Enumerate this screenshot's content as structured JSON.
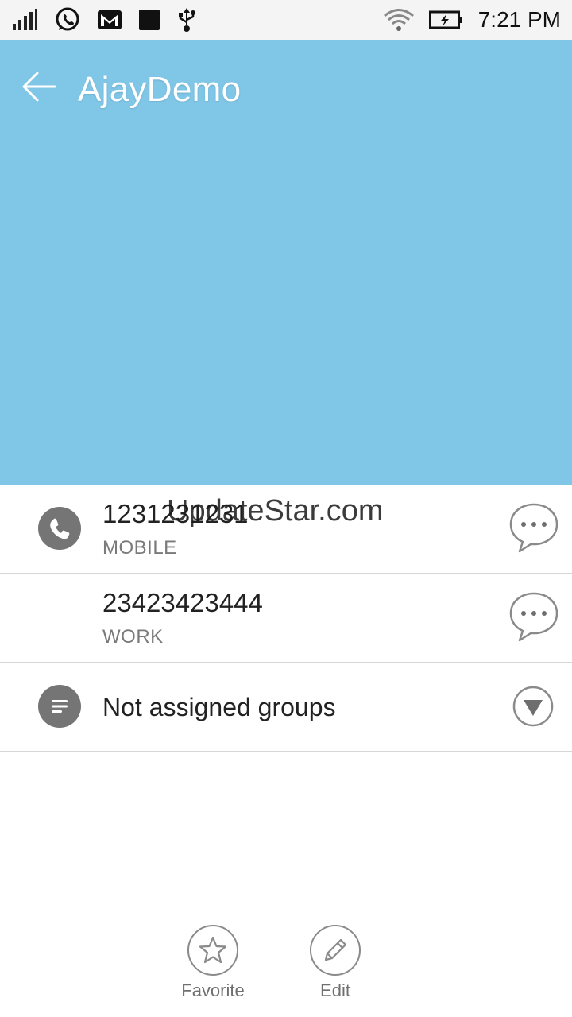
{
  "status_bar": {
    "time": "7:21 PM",
    "icons_left": [
      "signal-icon",
      "whatsapp-icon",
      "gmail-icon",
      "app-notification-icon",
      "usb-icon"
    ],
    "icons_right": [
      "wifi-icon",
      "battery-charging-icon"
    ]
  },
  "header": {
    "title": "AjayDemo",
    "background_color": "#80c6e7",
    "back_icon": "arrow-left-icon"
  },
  "phones": [
    {
      "number": "1231231231",
      "type": "MOBILE",
      "icon": "phone-icon",
      "action_icon": "message-bubble-icon"
    },
    {
      "number": "23423423444",
      "type": "WORK",
      "action_icon": "message-bubble-icon"
    }
  ],
  "groups": {
    "label": "Not assigned groups",
    "icon": "group-list-icon",
    "expand_icon": "triangle-down-icon"
  },
  "watermark": "UpdateStar.com",
  "actions": [
    {
      "label": "Favorite",
      "icon": "star-icon"
    },
    {
      "label": "Edit",
      "icon": "pencil-icon"
    }
  ]
}
